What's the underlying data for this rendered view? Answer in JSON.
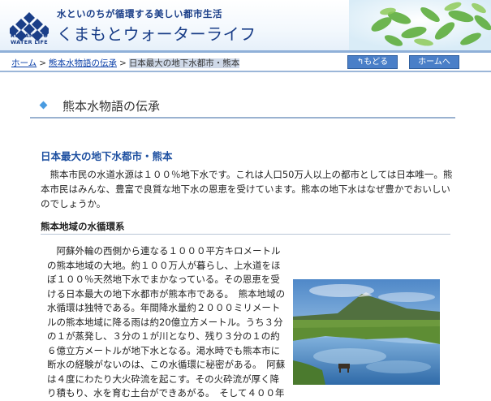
{
  "header": {
    "tagline": "水といのちが循環する美しい都市生活",
    "title": "くまもとウォーターライフ",
    "logo_text_1": "KUMAMOTO",
    "logo_text_2": "WATER LIFE"
  },
  "breadcrumb": {
    "items": [
      "ホーム",
      "熊本水物語の伝承",
      "日本最大の地下水都市・熊本"
    ],
    "separator": ">"
  },
  "nav": {
    "back_label": "もどる",
    "home_label": "ホームへ"
  },
  "section": {
    "title": "熊本水物語の伝承"
  },
  "article": {
    "heading": "日本最大の地下水都市・熊本",
    "lead": "熊本市民の水道水源は１００％地下水です。これは人口50万人以上の都市としては日本唯一。熊本市民はみんな、豊富で良質な地下水の恩恵を受けています。熊本の地下水はなぜ豊かでおいしいのでしょうか。",
    "subheading": "熊本地域の水循環系",
    "body": "阿蘇外輪の西側から連なる１０００平方キロメートルの熊本地域の大地。約１００万人が暮らし、上水道をほぼ１００％天然地下水でまかなっている。その恩恵を受ける日本最大の地下水都市が熊本市である。　熊本地域の水循環は独特である。年間降水量約２０００ミリメートルの熊本地域に降る雨は約20億立方メートル。うち３分の１が蒸発し、３分の１が川となり、残り３分の１の約６億立方メートルが地下水となる。渇水時でも熊本市に断水の経験がないのは、この水循環に秘密がある。　阿蘇は４度にわたり大火砕流を起こす。その火砕流が厚く降り積もり、水を育む土台ができあがる。　そして４００年"
  },
  "colors": {
    "brand": "#1a3e88",
    "link": "#0a3fa8",
    "heading_blue": "#1d4fa0",
    "button": "#4a7fc8"
  }
}
